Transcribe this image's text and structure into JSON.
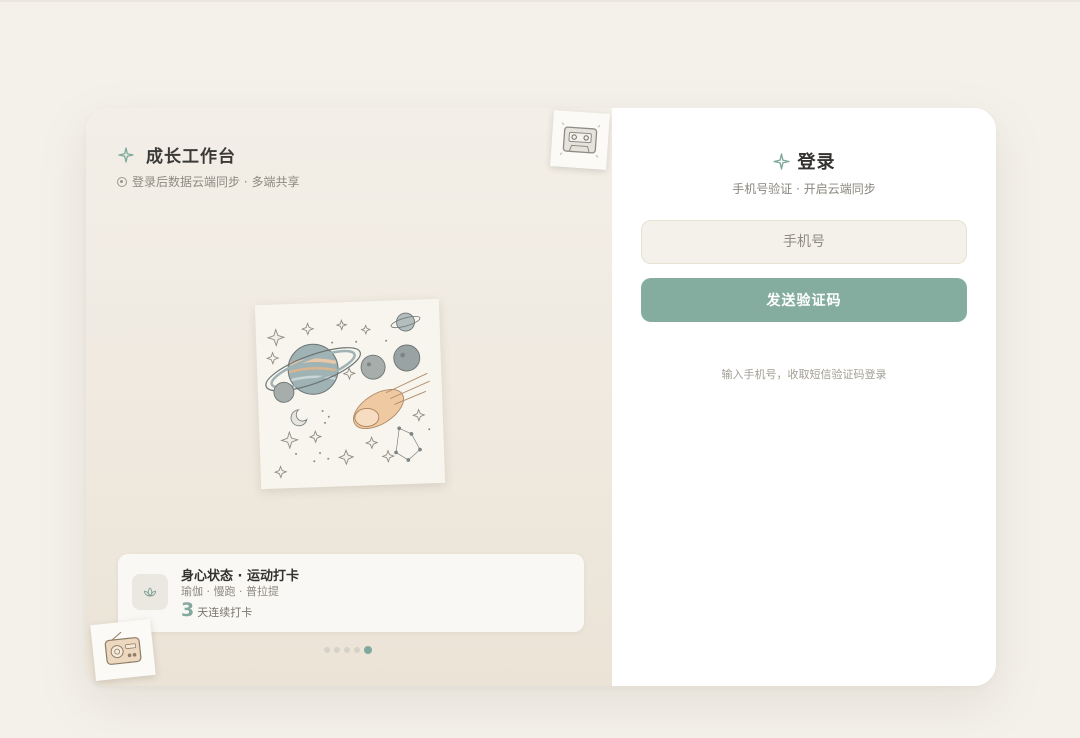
{
  "brand": {
    "title": "成长工作台",
    "subtitle": "登录后数据云端同步 · 多端共享"
  },
  "showcase": {
    "illustration_icon": "space-planets-illustration",
    "status_card": {
      "title": "身心状态 · 运动打卡",
      "tags": "瑜伽 · 慢跑 · 普拉提",
      "streak_number": "3",
      "streak_unit": "天连续打卡"
    },
    "carousel": {
      "total": 5,
      "active_index": 4
    }
  },
  "login": {
    "title": "登录",
    "subtitle": "手机号验证 · 开启云端同步",
    "phone_placeholder": "手机号",
    "phone_value": "",
    "send_button": "发送验证码",
    "hint": "输入手机号，收取短信验证码登录"
  },
  "colors": {
    "page_bg": "#f4f1eb",
    "accent": "#85ad9f",
    "streak_number": "#84a99f",
    "text_primary": "#3b3a36",
    "text_secondary": "#8e8a82"
  }
}
